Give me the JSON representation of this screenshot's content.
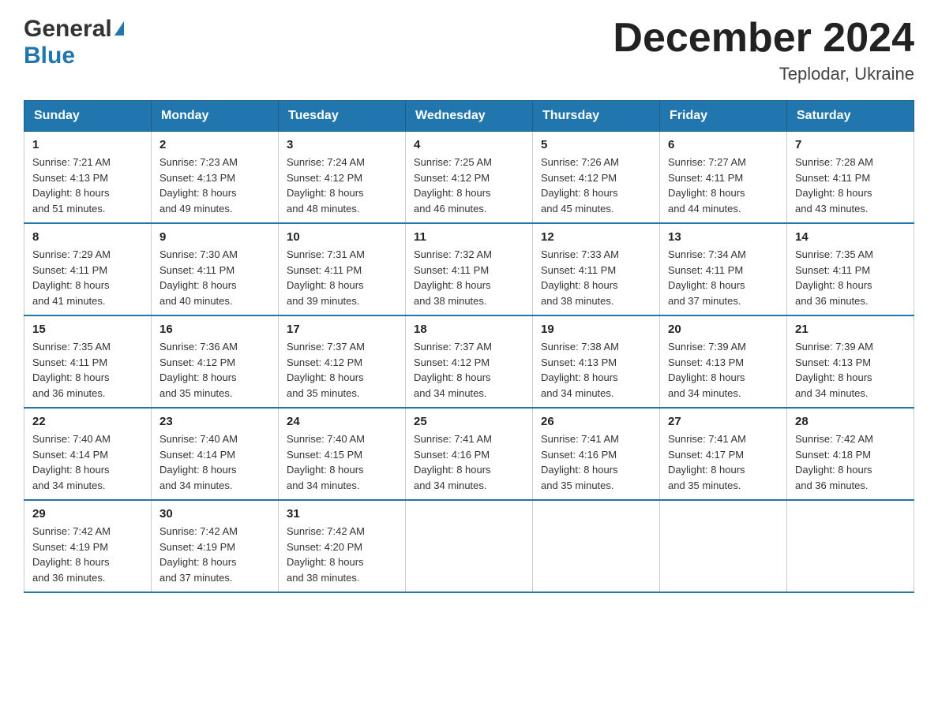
{
  "header": {
    "logo_text_general": "General",
    "logo_text_blue": "Blue",
    "month_title": "December 2024",
    "location": "Teplodar, Ukraine"
  },
  "weekdays": [
    "Sunday",
    "Monday",
    "Tuesday",
    "Wednesday",
    "Thursday",
    "Friday",
    "Saturday"
  ],
  "weeks": [
    [
      {
        "day": "1",
        "sunrise": "7:21 AM",
        "sunset": "4:13 PM",
        "daylight": "8 hours and 51 minutes."
      },
      {
        "day": "2",
        "sunrise": "7:23 AM",
        "sunset": "4:13 PM",
        "daylight": "8 hours and 49 minutes."
      },
      {
        "day": "3",
        "sunrise": "7:24 AM",
        "sunset": "4:12 PM",
        "daylight": "8 hours and 48 minutes."
      },
      {
        "day": "4",
        "sunrise": "7:25 AM",
        "sunset": "4:12 PM",
        "daylight": "8 hours and 46 minutes."
      },
      {
        "day": "5",
        "sunrise": "7:26 AM",
        "sunset": "4:12 PM",
        "daylight": "8 hours and 45 minutes."
      },
      {
        "day": "6",
        "sunrise": "7:27 AM",
        "sunset": "4:11 PM",
        "daylight": "8 hours and 44 minutes."
      },
      {
        "day": "7",
        "sunrise": "7:28 AM",
        "sunset": "4:11 PM",
        "daylight": "8 hours and 43 minutes."
      }
    ],
    [
      {
        "day": "8",
        "sunrise": "7:29 AM",
        "sunset": "4:11 PM",
        "daylight": "8 hours and 41 minutes."
      },
      {
        "day": "9",
        "sunrise": "7:30 AM",
        "sunset": "4:11 PM",
        "daylight": "8 hours and 40 minutes."
      },
      {
        "day": "10",
        "sunrise": "7:31 AM",
        "sunset": "4:11 PM",
        "daylight": "8 hours and 39 minutes."
      },
      {
        "day": "11",
        "sunrise": "7:32 AM",
        "sunset": "4:11 PM",
        "daylight": "8 hours and 38 minutes."
      },
      {
        "day": "12",
        "sunrise": "7:33 AM",
        "sunset": "4:11 PM",
        "daylight": "8 hours and 38 minutes."
      },
      {
        "day": "13",
        "sunrise": "7:34 AM",
        "sunset": "4:11 PM",
        "daylight": "8 hours and 37 minutes."
      },
      {
        "day": "14",
        "sunrise": "7:35 AM",
        "sunset": "4:11 PM",
        "daylight": "8 hours and 36 minutes."
      }
    ],
    [
      {
        "day": "15",
        "sunrise": "7:35 AM",
        "sunset": "4:11 PM",
        "daylight": "8 hours and 36 minutes."
      },
      {
        "day": "16",
        "sunrise": "7:36 AM",
        "sunset": "4:12 PM",
        "daylight": "8 hours and 35 minutes."
      },
      {
        "day": "17",
        "sunrise": "7:37 AM",
        "sunset": "4:12 PM",
        "daylight": "8 hours and 35 minutes."
      },
      {
        "day": "18",
        "sunrise": "7:37 AM",
        "sunset": "4:12 PM",
        "daylight": "8 hours and 34 minutes."
      },
      {
        "day": "19",
        "sunrise": "7:38 AM",
        "sunset": "4:13 PM",
        "daylight": "8 hours and 34 minutes."
      },
      {
        "day": "20",
        "sunrise": "7:39 AM",
        "sunset": "4:13 PM",
        "daylight": "8 hours and 34 minutes."
      },
      {
        "day": "21",
        "sunrise": "7:39 AM",
        "sunset": "4:13 PM",
        "daylight": "8 hours and 34 minutes."
      }
    ],
    [
      {
        "day": "22",
        "sunrise": "7:40 AM",
        "sunset": "4:14 PM",
        "daylight": "8 hours and 34 minutes."
      },
      {
        "day": "23",
        "sunrise": "7:40 AM",
        "sunset": "4:14 PM",
        "daylight": "8 hours and 34 minutes."
      },
      {
        "day": "24",
        "sunrise": "7:40 AM",
        "sunset": "4:15 PM",
        "daylight": "8 hours and 34 minutes."
      },
      {
        "day": "25",
        "sunrise": "7:41 AM",
        "sunset": "4:16 PM",
        "daylight": "8 hours and 34 minutes."
      },
      {
        "day": "26",
        "sunrise": "7:41 AM",
        "sunset": "4:16 PM",
        "daylight": "8 hours and 35 minutes."
      },
      {
        "day": "27",
        "sunrise": "7:41 AM",
        "sunset": "4:17 PM",
        "daylight": "8 hours and 35 minutes."
      },
      {
        "day": "28",
        "sunrise": "7:42 AM",
        "sunset": "4:18 PM",
        "daylight": "8 hours and 36 minutes."
      }
    ],
    [
      {
        "day": "29",
        "sunrise": "7:42 AM",
        "sunset": "4:19 PM",
        "daylight": "8 hours and 36 minutes."
      },
      {
        "day": "30",
        "sunrise": "7:42 AM",
        "sunset": "4:19 PM",
        "daylight": "8 hours and 37 minutes."
      },
      {
        "day": "31",
        "sunrise": "7:42 AM",
        "sunset": "4:20 PM",
        "daylight": "8 hours and 38 minutes."
      },
      null,
      null,
      null,
      null
    ]
  ],
  "labels": {
    "sunrise": "Sunrise:",
    "sunset": "Sunset:",
    "daylight": "Daylight:"
  }
}
